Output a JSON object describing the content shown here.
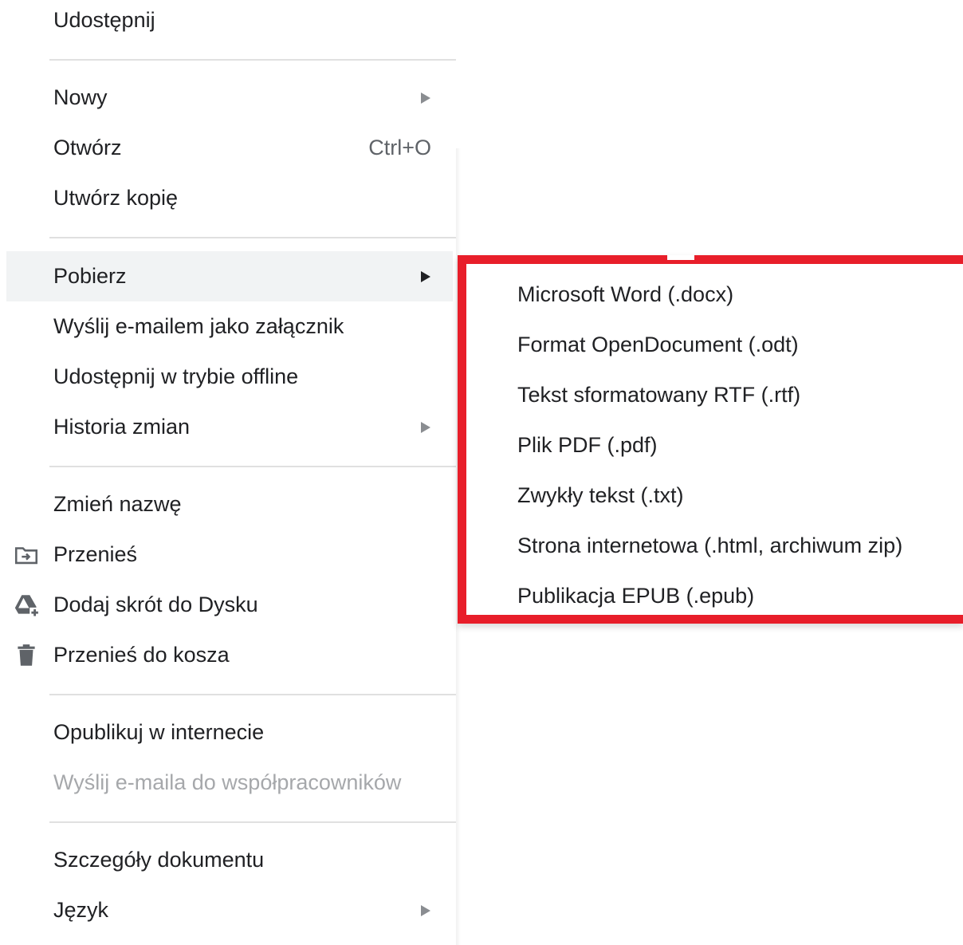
{
  "menu": {
    "items": [
      {
        "label": "Udostępnij"
      },
      {
        "label": "Nowy"
      },
      {
        "label": "Otwórz",
        "shortcut": "Ctrl+O"
      },
      {
        "label": "Utwórz kopię"
      },
      {
        "label": "Pobierz"
      },
      {
        "label": "Wyślij e-mailem jako załącznik"
      },
      {
        "label": "Udostępnij w trybie offline"
      },
      {
        "label": "Historia zmian"
      },
      {
        "label": "Zmień nazwę"
      },
      {
        "label": "Przenieś",
        "icon": "folder-move-icon"
      },
      {
        "label": "Dodaj skrót do Dysku",
        "icon": "drive-add-shortcut-icon"
      },
      {
        "label": "Przenieś do kosza",
        "icon": "trash-icon"
      },
      {
        "label": "Opublikuj w internecie"
      },
      {
        "label": "Wyślij e-maila do współpracowników"
      },
      {
        "label": "Szczegóły dokumentu"
      },
      {
        "label": "Język"
      }
    ]
  },
  "submenu": {
    "items": [
      {
        "label": "Microsoft Word (.docx)"
      },
      {
        "label": "Format OpenDocument (.odt)"
      },
      {
        "label": "Tekst sformatowany RTF (.rtf)"
      },
      {
        "label": "Plik PDF (.pdf)"
      },
      {
        "label": "Zwykły tekst (.txt)"
      },
      {
        "label": "Strona internetowa (.html, archiwum zip)"
      },
      {
        "label": "Publikacja EPUB (.epub)"
      }
    ],
    "highlight_color": "#e81e2a"
  },
  "colors": {
    "text": "#202124",
    "disabled_text": "#a6a8ab",
    "active_background": "#f1f3f4",
    "divider": "#e0e0e0"
  }
}
